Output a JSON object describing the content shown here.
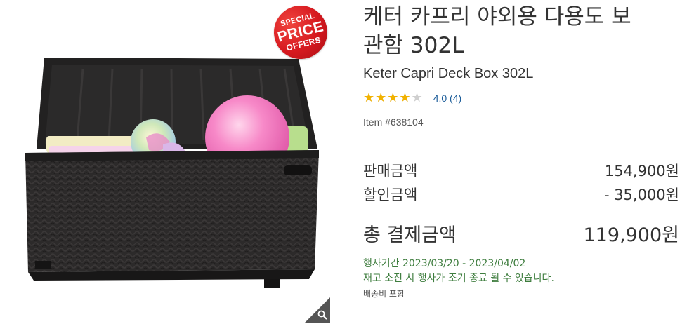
{
  "badge": {
    "line1": "SPECIAL",
    "line2": "PRICE",
    "line3": "OFFERS"
  },
  "product": {
    "title_ko_line1": "케터 카프리 야외용 다용도 보",
    "title_ko_line2": "관함 302L",
    "title_en": "Keter Capri Deck Box 302L",
    "rating": 4.0,
    "rating_max": 5,
    "rating_text": "4.0 (4)",
    "item_number": "Item #638104"
  },
  "pricing": {
    "sale_label": "판매금액",
    "sale_value": "154,900원",
    "discount_label": "할인금액",
    "discount_value": "- 35,000원",
    "total_label": "총 결제금액",
    "total_value": "119,900원"
  },
  "promo": {
    "period": "행사기간 2023/03/20 - 2023/04/02",
    "note": "재고 소진 시 행사가 조기 종료 될 수 있습니다.",
    "shipping": "배송비 포함"
  },
  "icons": {
    "zoom": "magnifier-icon",
    "star": "star-icon"
  },
  "colors": {
    "badge": "#d6191f",
    "star": "#f2b200",
    "link": "#1b5c99",
    "promo": "#3e7d3e"
  }
}
